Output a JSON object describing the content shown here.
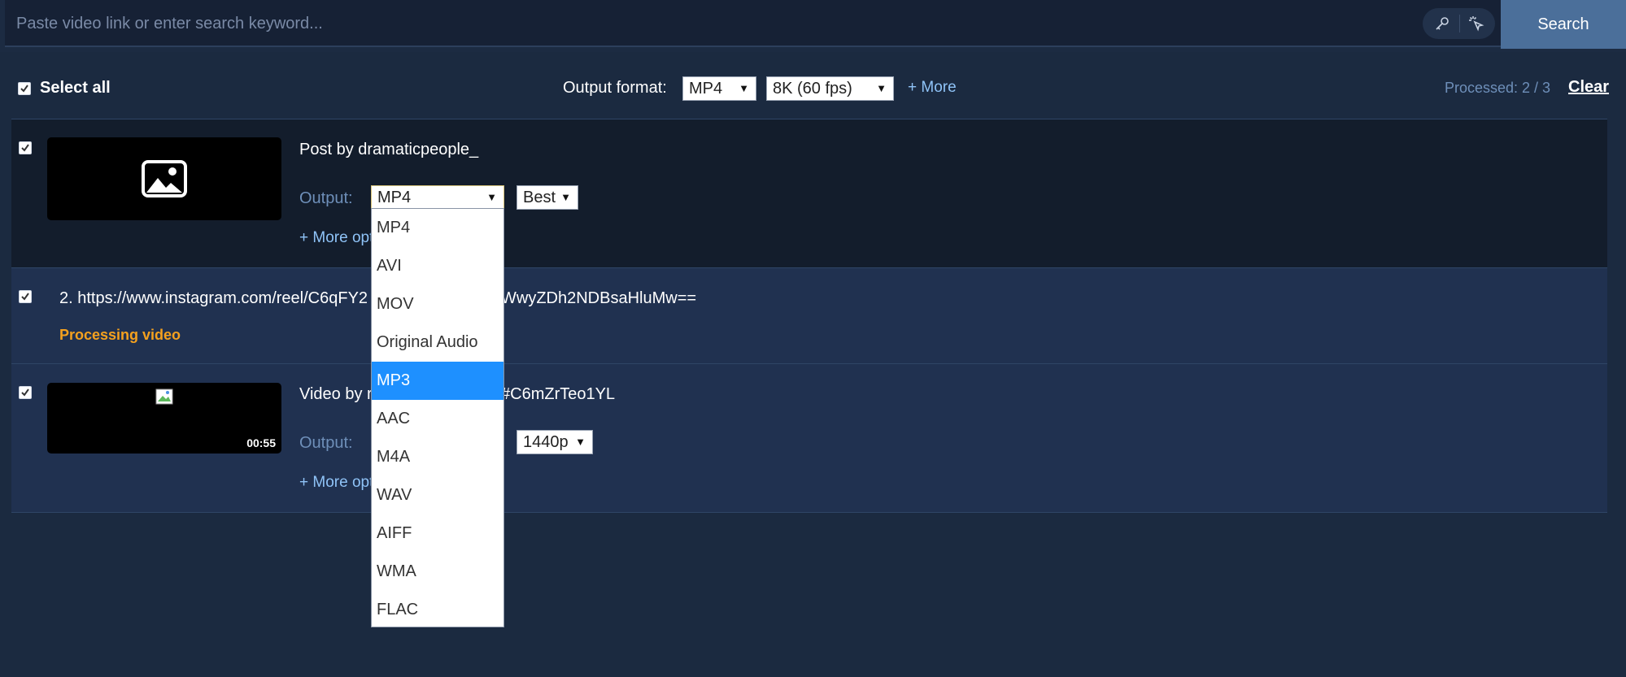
{
  "search": {
    "placeholder": "Paste video link or enter search keyword...",
    "button_label": "Search",
    "icons": [
      "key-icon",
      "magic-cursor-icon"
    ]
  },
  "toolbar": {
    "select_all_label": "Select all",
    "select_all_checked": true,
    "output_format_label": "Output format:",
    "format_value": "MP4",
    "quality_value": "8K (60 fps)",
    "more_label": "+ More",
    "processed_text": "Processed: 2 / 3",
    "clear_label": "Clear"
  },
  "items": [
    {
      "checked": true,
      "title": "Post by dramaticpeople_",
      "output_label": "Output:",
      "format_value": "MP4",
      "quality_value": "Best",
      "more_options_label": "+ More opt",
      "thumbnail_icon": "image-placeholder-icon"
    },
    {
      "checked": true,
      "url_text": "2. https://www.instagram.com/reel/C6qFY2",
      "url_tail": "WwyZDh2NDBsaHluMw==",
      "status": "Processing video"
    },
    {
      "checked": true,
      "title_start": "Video by r",
      "title_end": "#C6mZrTeo1YL",
      "output_label": "Output:",
      "quality_value": "1440p",
      "more_options_label": "+ More opt",
      "duration": "00:55"
    }
  ],
  "dropdown": {
    "selected": "MP3",
    "options": [
      "MP4",
      "AVI",
      "MOV",
      "Original Audio",
      "MP3",
      "AAC",
      "M4A",
      "WAV",
      "AIFF",
      "WMA",
      "FLAC"
    ]
  },
  "colors": {
    "background": "#1b2a40",
    "accent_link": "#8fc3f7",
    "processing": "#f5a11e",
    "selected_option": "#1e90ff",
    "search_button": "#4b6f9a"
  }
}
